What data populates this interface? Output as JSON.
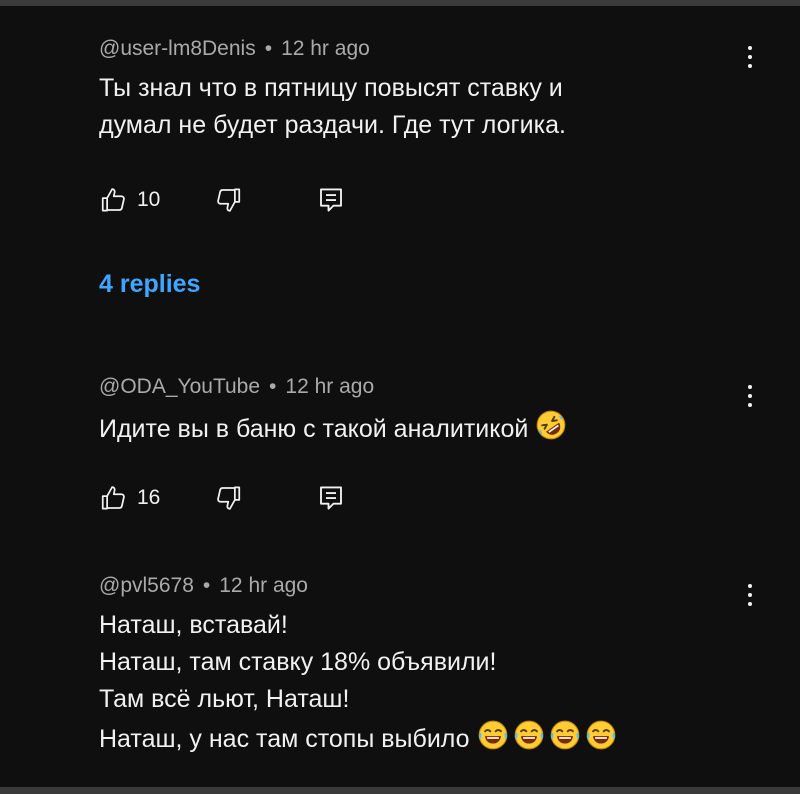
{
  "comments": [
    {
      "author": "@user-lm8Denis",
      "separator": "•",
      "time": "12 hr ago",
      "lines": [
        "Ты знал что в пятницу повысят ставку и",
        "думал не будет раздачи. Где тут логика."
      ],
      "likes": "10",
      "emoji": []
    },
    {
      "author": "@ODA_YouTube",
      "separator": "•",
      "time": "12 hr ago",
      "lines": [
        "Идите вы в баню с такой аналитикой"
      ],
      "likes": "16",
      "emoji": [
        "rolling-on-floor-laughing"
      ]
    },
    {
      "author": "@pvl5678",
      "separator": "•",
      "time": "12 hr ago",
      "lines": [
        "Наташ, вставай!",
        "Наташ, там ставку 18% объявили!",
        "Там всё льют, Наташ!",
        "Наташ, у нас там стопы выбило"
      ],
      "likes": null,
      "emoji": [
        "face-with-tears-of-joy",
        "face-with-tears-of-joy",
        "face-with-tears-of-joy",
        "face-with-tears-of-joy"
      ]
    }
  ],
  "replies_link": "4 replies",
  "icons": {
    "like": "thumbs-up-icon",
    "dislike": "thumbs-down-icon",
    "reply": "reply-icon",
    "menu": "more-vertical-icon"
  },
  "colors": {
    "background": "#0f0f0f",
    "primary_text": "#f1f1f1",
    "secondary_text": "#aaaaaa",
    "link": "#3ea6ff",
    "emoji": "#ffcc33"
  }
}
